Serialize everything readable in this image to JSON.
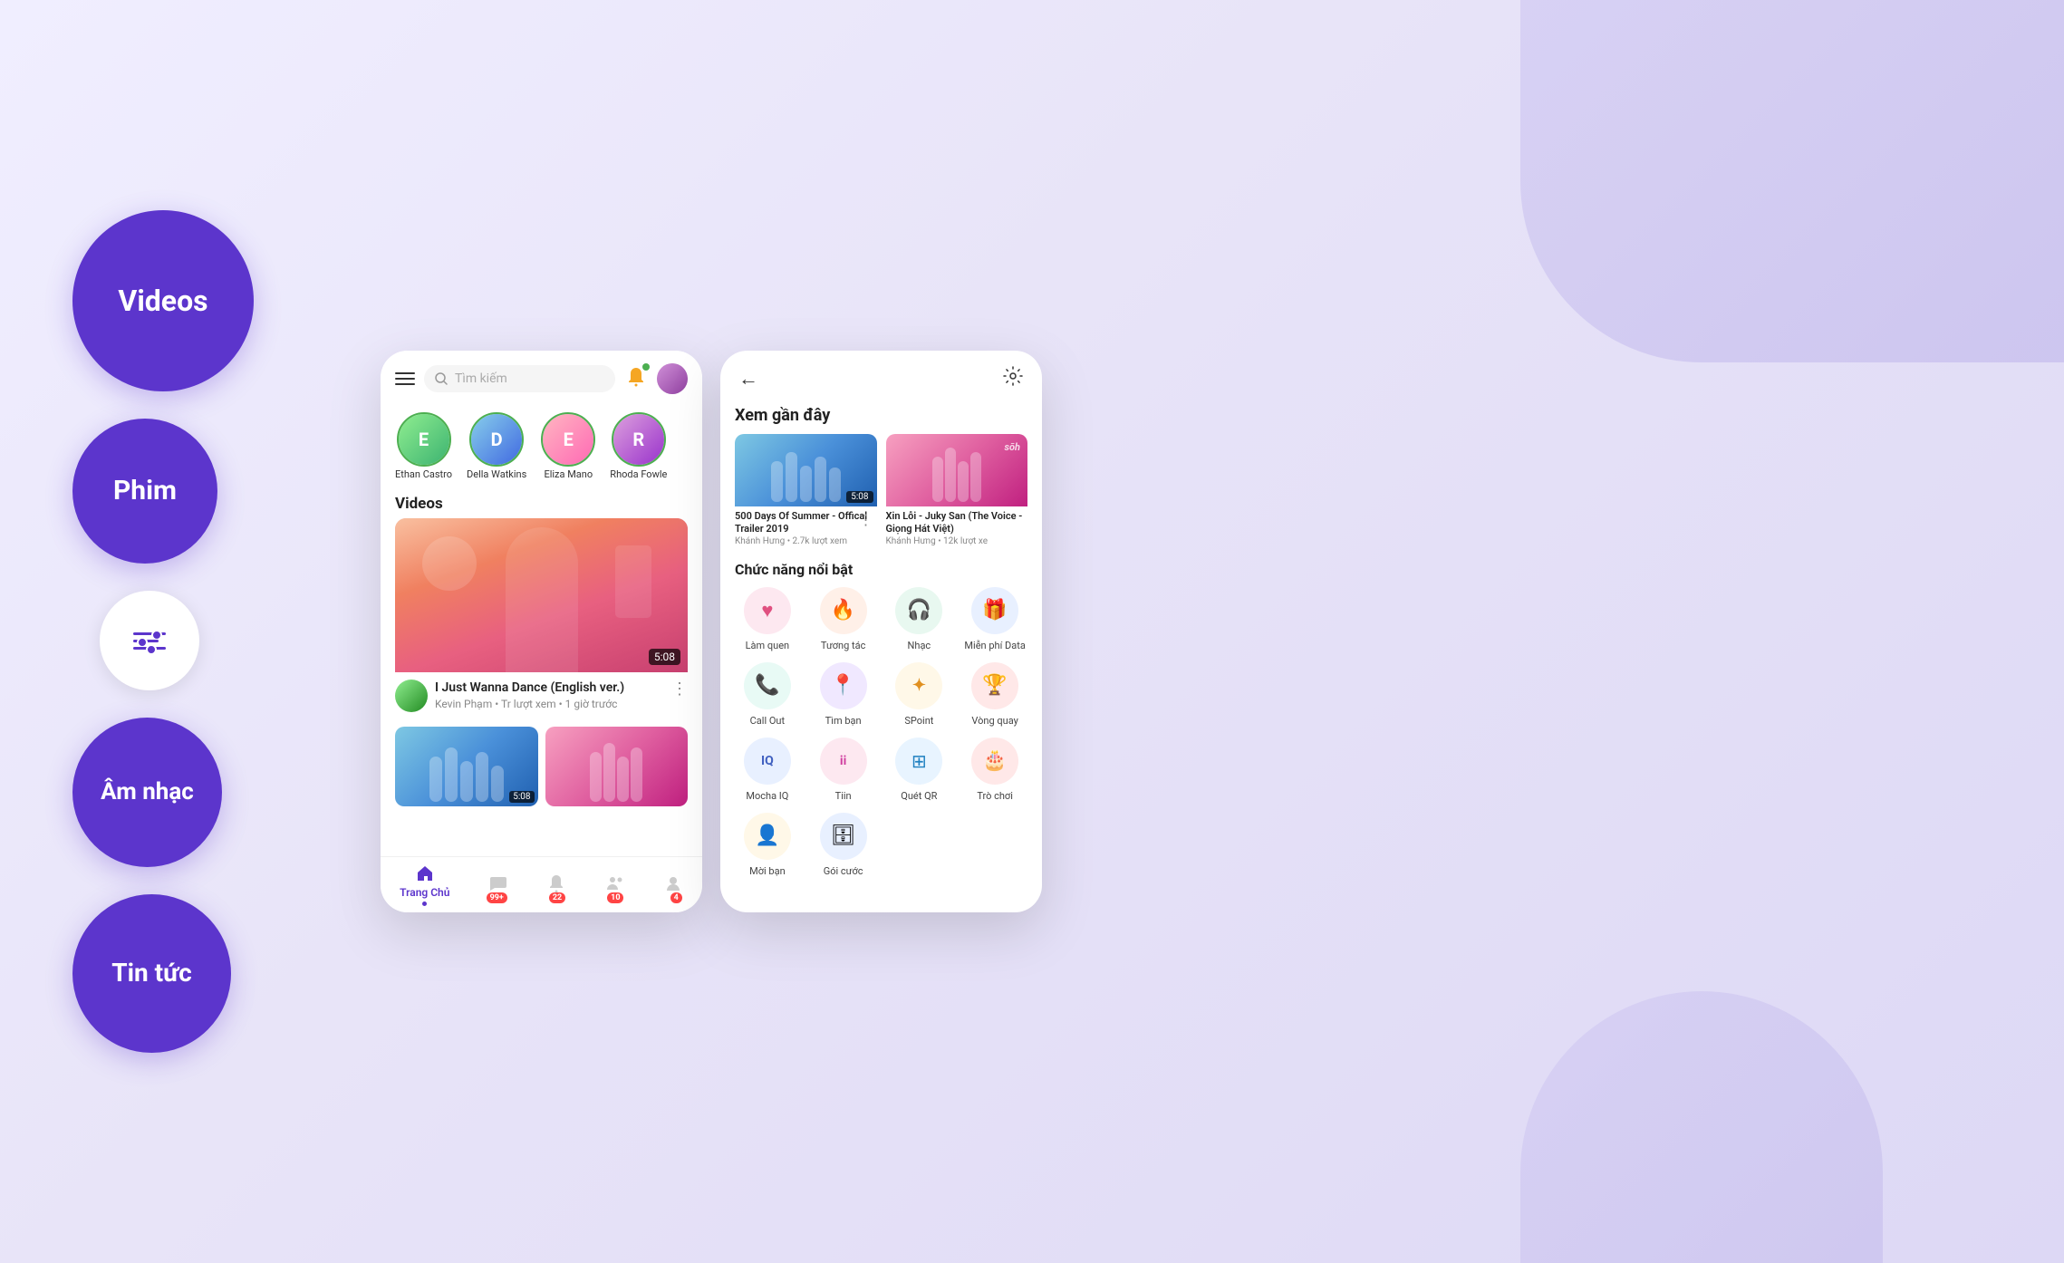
{
  "background": {
    "color": "#ede8fa"
  },
  "left_nav": {
    "circles": [
      {
        "id": "videos",
        "label": "Videos",
        "size": "large"
      },
      {
        "id": "phim",
        "label": "Phim",
        "size": "medium"
      },
      {
        "id": "filter",
        "label": "filter",
        "size": "filter"
      },
      {
        "id": "am-nhac",
        "label": "Âm nhạc",
        "size": "medium"
      },
      {
        "id": "tin-tuc",
        "label": "Tin tức",
        "size": "medium"
      }
    ]
  },
  "phone1": {
    "header": {
      "search_placeholder": "Tìm kiếm"
    },
    "stories": [
      {
        "name": "Ethan Castro",
        "color": "#7bc67e"
      },
      {
        "name": "Della Watkins",
        "color": "#6ab0de"
      },
      {
        "name": "Eliza Mano",
        "color": "#e87aad"
      },
      {
        "name": "Rhoda Fowle",
        "color": "#c07acc"
      }
    ],
    "section_label": "Videos",
    "main_video": {
      "title": "I Just Wanna Dance (English ver.)",
      "channel": "Kevin Phạm",
      "views": "Tr lượt xem",
      "time": "1 giờ trước",
      "duration": "5:08"
    },
    "bottom_nav": [
      {
        "label": "Trang Chủ",
        "active": true,
        "badge": null
      },
      {
        "label": "",
        "active": false,
        "badge": "99+"
      },
      {
        "label": "",
        "active": false,
        "badge": "22"
      },
      {
        "label": "",
        "active": false,
        "badge": "10"
      },
      {
        "label": "",
        "active": false,
        "badge": "4"
      }
    ]
  },
  "phone2": {
    "recent_section": {
      "title": "Xem gần đây",
      "videos": [
        {
          "title": "500 Days Of Summer - Offical Trailer 2019",
          "channel": "Khánh Hưng",
          "views": "2.7k lượt xem",
          "duration": "5:08"
        },
        {
          "title": "Xin Lỗi - Juky San (The Voice - Giọng Hát Việt)",
          "channel": "Khánh Hưng",
          "views": "12k lượt xe",
          "duration": ""
        }
      ]
    },
    "features_section": {
      "title": "Chức năng nổi bật",
      "features": [
        {
          "id": "lam-quen",
          "label": "Làm quen",
          "icon": "♥",
          "color": "fi-pink"
        },
        {
          "id": "tuong-tac",
          "label": "Tương tác",
          "icon": "🔥",
          "color": "fi-orange"
        },
        {
          "id": "nhac",
          "label": "Nhạc",
          "icon": "🎧",
          "color": "fi-green"
        },
        {
          "id": "mien-phi-data",
          "label": "Miễn phí Data",
          "icon": "🎁",
          "color": "fi-blue"
        },
        {
          "id": "call-out",
          "label": "Call Out",
          "icon": "📞",
          "color": "fi-teal"
        },
        {
          "id": "tim-ban",
          "label": "Tìm bạn",
          "icon": "📍",
          "color": "fi-purple"
        },
        {
          "id": "spoint",
          "label": "SPoint",
          "icon": "✦",
          "color": "fi-yellow"
        },
        {
          "id": "vong-quay",
          "label": "Vòng quay",
          "icon": "🏆",
          "color": "fi-red"
        },
        {
          "id": "mocha-iq",
          "label": "Mocha IQ",
          "icon": "IQ",
          "color": "fi-blue"
        },
        {
          "id": "tiin",
          "label": "Tiin",
          "icon": "ii",
          "color": "fi-pink"
        },
        {
          "id": "quet-qr",
          "label": "Quét QR",
          "icon": "⊞",
          "color": "fi-lightblue"
        },
        {
          "id": "tro-choi",
          "label": "Trò chơi",
          "icon": "🎂",
          "color": "fi-red"
        },
        {
          "id": "moi-ban",
          "label": "Mời bạn",
          "icon": "👤",
          "color": "fi-yellow"
        },
        {
          "id": "goi-cuoc",
          "label": "Gói cước",
          "icon": "🗄",
          "color": "fi-blue"
        }
      ]
    }
  }
}
